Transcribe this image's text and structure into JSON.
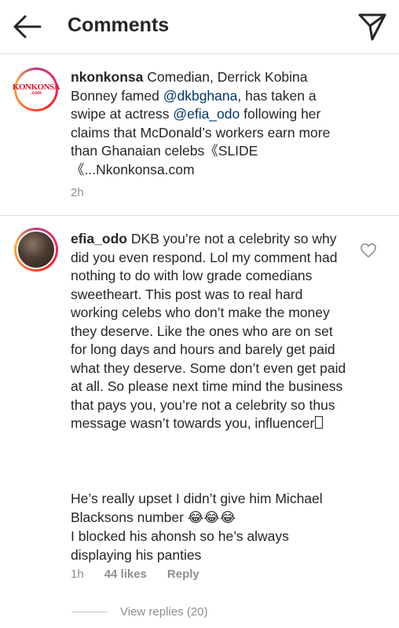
{
  "header": {
    "back_icon": "arrow-left-icon",
    "title": "Comments",
    "share_icon": "send-paper-plane-icon"
  },
  "caption": {
    "avatar_logo_text": "KONKONSA",
    "avatar_logo_sub": ".com",
    "username": "nkonkonsa",
    "text_part1": " Comedian, Derrick Kobina Bonney famed ",
    "mention1": "@dkbghana",
    "text_part2": ", has taken a swipe at actress ",
    "mention2": "@efia_odo",
    "text_part3": " following her claims that McDonald’s workers earn more than Ghanaian celebs《SLIDE《...Nkonkonsa.com",
    "time": "2h"
  },
  "comment": {
    "username": "efia_odo",
    "text_main": " DKB you’re not a celebrity so why did you even respond. Lol my comment had nothing to do with low grade comedians sweetheart. This post was to real hard working celebs who don’t make the money they deserve. Like the ones who are on set for long days and hours and barely get paid what they deserve. Some don’t even get paid at all. So please next time mind the business that pays you, you’re not a celebrity so thus message wasn’t towards you, influencer",
    "text_line_a": "He’s really upset I didn’t give him Michael Blacksons number ",
    "laugh_emojis": "😂😂😂",
    "text_line_b": "I blocked his ahonsh so he’s always displaying his panties",
    "time": "1h",
    "likes": "44 likes",
    "reply": "Reply",
    "view_replies": "View replies (20)",
    "heart_icon": "heart-outline-icon"
  }
}
